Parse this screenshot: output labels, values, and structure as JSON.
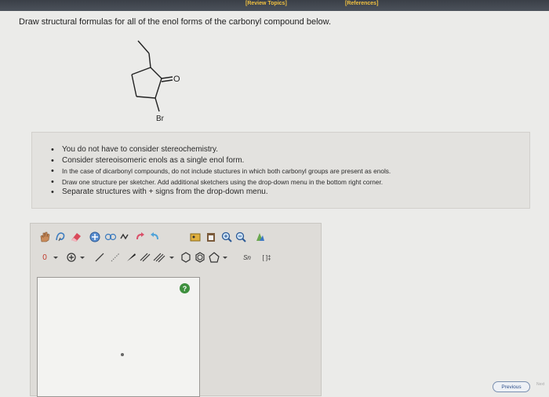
{
  "header": {
    "review_topics": "[Review Topics]",
    "references": "[References]"
  },
  "question": {
    "instruction": "Draw structural formulas for all of the enol forms of the carbonyl compound below."
  },
  "molecule": {
    "oxygen_label": "O",
    "bromine_label": "Br"
  },
  "rules": [
    "You do not have to consider stereochemistry.",
    "Consider stereoisomeric enols as a single enol form.",
    "In the case of dicarbonyl compounds, do not include stuctures in which both carbonyl groups are present as enols.",
    "Draw one structure per sketcher. Add additional sketchers using the drop-down menu in the bottom right corner.",
    "Separate structures with + signs from the drop-down menu."
  ],
  "sketcher": {
    "charge_label": "0",
    "help_label": "?",
    "bracket_label": "[ ]‡",
    "template_label": "Sn"
  },
  "footer": {
    "previous_label": "Previous",
    "next_label": "Next"
  },
  "colors": {
    "header_bg": "#3a3f47",
    "header_link": "#f0c040",
    "help_green": "#3d8f3d"
  }
}
